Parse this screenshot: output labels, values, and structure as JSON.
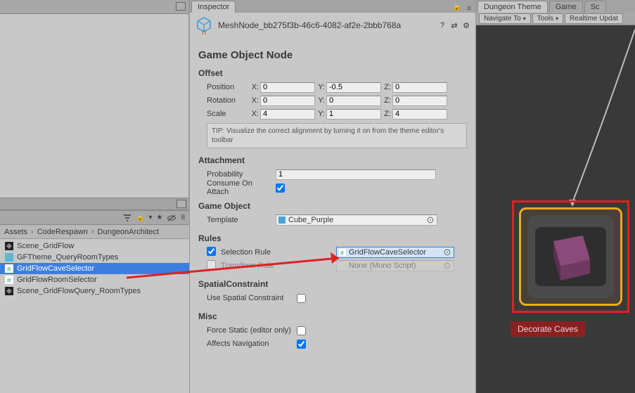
{
  "inspector": {
    "tab_label": "Inspector",
    "object_name": "MeshNode_bb275f3b-46c6-4082-af2e-2bbb768a",
    "title": "Game Object Node",
    "offset": {
      "title": "Offset",
      "position_label": "Position",
      "rotation_label": "Rotation",
      "scale_label": "Scale",
      "position": {
        "x": "0",
        "y": "-0.5",
        "z": "0"
      },
      "rotation": {
        "x": "0",
        "y": "0",
        "z": "0"
      },
      "scale": {
        "x": "4",
        "y": "1",
        "z": "4"
      },
      "tip": "TIP: Visualize the correct alignment by turning it on from the theme editor's toolbar"
    },
    "attachment": {
      "title": "Attachment",
      "probability_label": "Probability",
      "probability": "1",
      "consume_label": "Consume On Attach",
      "consume": true
    },
    "game_object": {
      "title": "Game Object",
      "template_label": "Template",
      "template": "Cube_Purple"
    },
    "rules": {
      "title": "Rules",
      "selection_label": "Selection Rule",
      "selection_enabled": true,
      "selection_value": "GridFlowCaveSelector",
      "transform_label": "Transform Rule",
      "transform_enabled": false,
      "transform_value": "None (Mono Script)"
    },
    "spatial": {
      "title": "SpatialConstraint",
      "use_label": "Use Spatial Constraint",
      "use": false
    },
    "misc": {
      "title": "Misc",
      "force_static_label": "Force Static (editor only)",
      "force_static": false,
      "affects_nav_label": "Affects Navigation",
      "affects_nav": true
    }
  },
  "breadcrumb": {
    "items": [
      "Assets",
      "CodeRespawn",
      "DungeonArchitect"
    ]
  },
  "assets": {
    "items": [
      {
        "icon": "unity",
        "label": "Scene_GridFlow"
      },
      {
        "icon": "asset",
        "label": "GFTheme_QueryRoomTypes"
      },
      {
        "icon": "script",
        "label": "GridFlowCaveSelector",
        "selected": true
      },
      {
        "icon": "script",
        "label": "GridFlowRoomSelector"
      },
      {
        "icon": "unity",
        "label": "Scene_GridFlowQuery_RoomTypes"
      }
    ]
  },
  "toolbar": {
    "lock_icon": "🔒",
    "dropdown_icon": "▾",
    "eye_icon": "👁",
    "count": "8"
  },
  "right": {
    "tab1": "Dungeon Theme",
    "tab2": "Game",
    "tab3": "Sc",
    "nav_label": "Navigate To",
    "tools_label": "Tools",
    "realtime_label": "Realtime Updat"
  },
  "node": {
    "label": "Decorate Caves"
  },
  "axis_labels": {
    "x": "X:",
    "y": "Y:",
    "z": "Z:"
  }
}
